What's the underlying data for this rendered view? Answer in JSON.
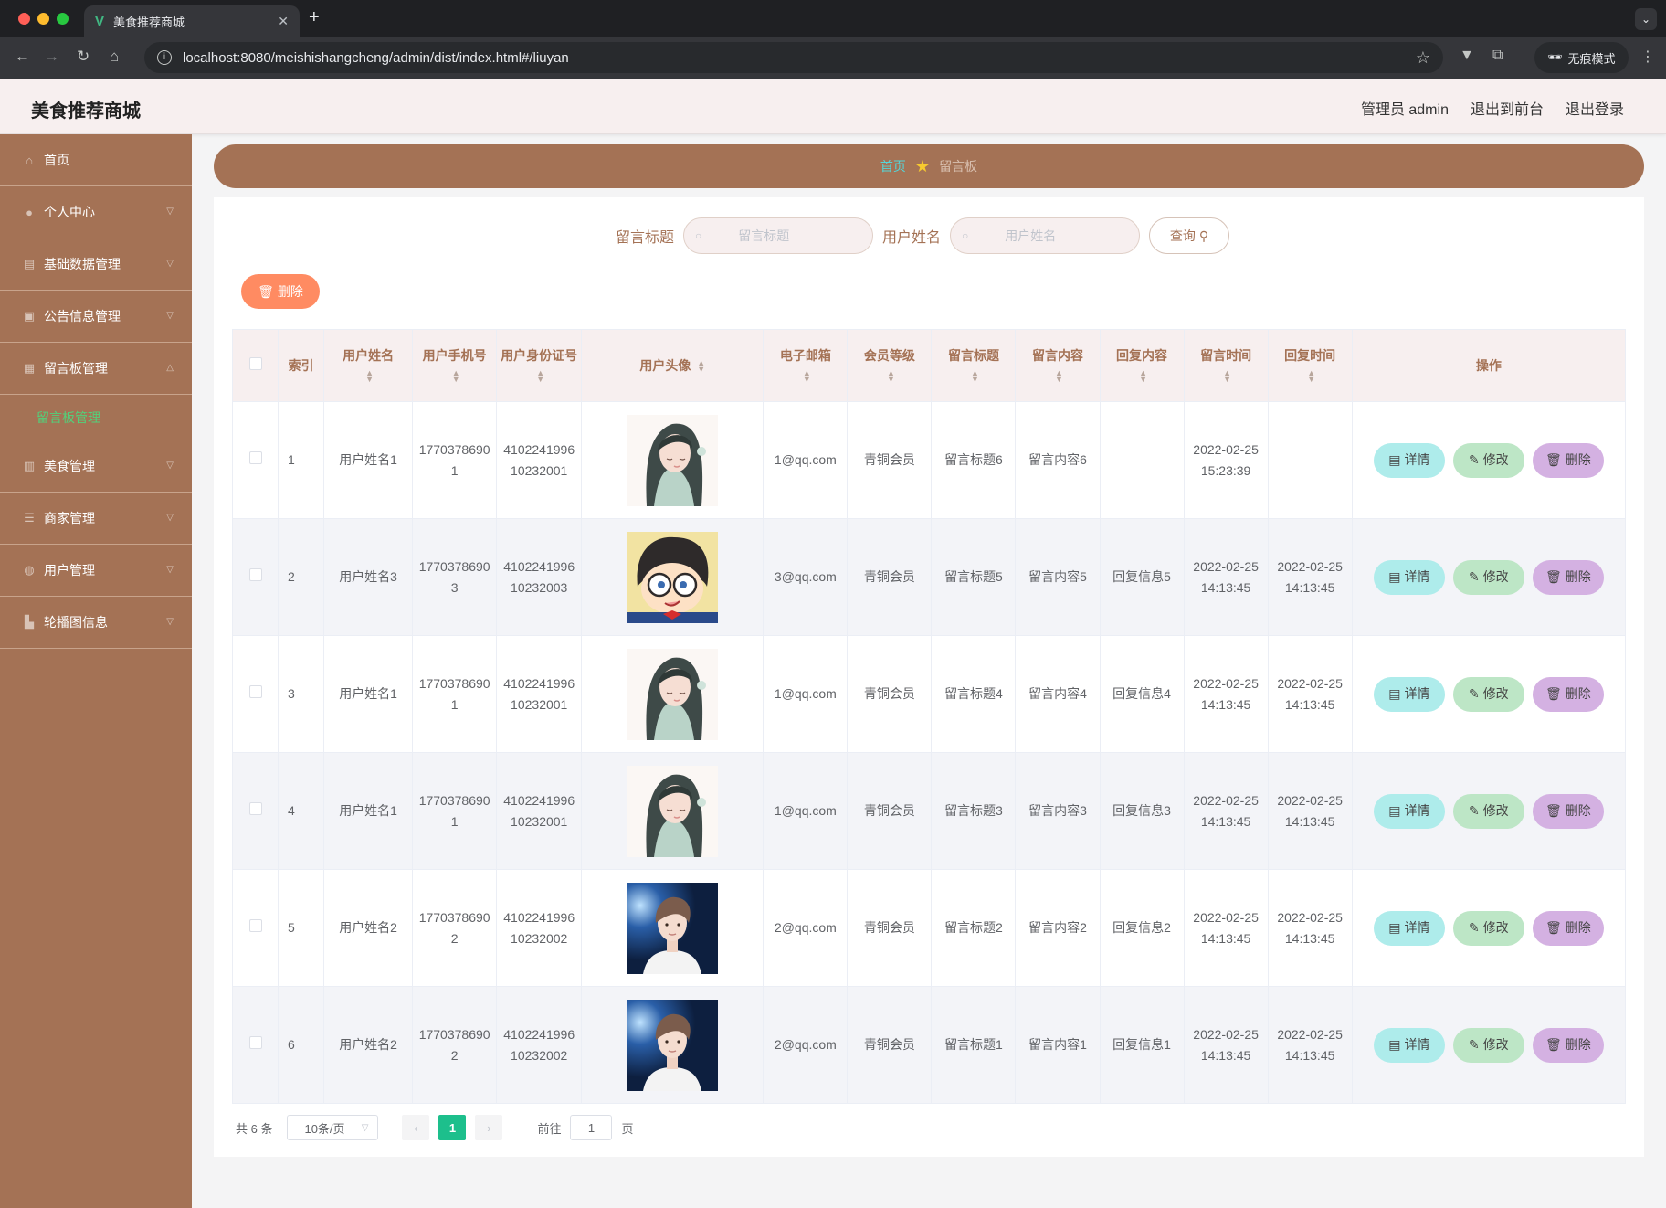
{
  "browser": {
    "tab_title": "美食推荐商城",
    "url": "localhost:8080/meishishangcheng/admin/dist/index.html#/liuyan",
    "incognito_label": "无痕模式"
  },
  "header": {
    "title": "美食推荐商城",
    "user": "管理员 admin",
    "to_front": "退出到前台",
    "logout": "退出登录"
  },
  "sidebar": {
    "items": [
      {
        "label": "首页",
        "icon": "home-icon"
      },
      {
        "label": "个人中心",
        "icon": "user-icon"
      },
      {
        "label": "基础数据管理",
        "icon": "data-icon"
      },
      {
        "label": "公告信息管理",
        "icon": "notice-icon"
      },
      {
        "label": "留言板管理",
        "icon": "grid-icon"
      },
      {
        "label": "美食管理",
        "icon": "food-icon"
      },
      {
        "label": "商家管理",
        "icon": "list-icon"
      },
      {
        "label": "用户管理",
        "icon": "users-icon"
      },
      {
        "label": "轮播图信息",
        "icon": "chart-icon"
      }
    ],
    "active_sub": "留言板管理"
  },
  "breadcrumb": {
    "home": "首页",
    "current": "留言板"
  },
  "search": {
    "title_label": "留言标题",
    "title_placeholder": "留言标题",
    "name_label": "用户姓名",
    "name_placeholder": "用户姓名",
    "query_button": "查询"
  },
  "toolbar": {
    "delete_label": "删除"
  },
  "table": {
    "headers": {
      "index": "索引",
      "name": "用户姓名",
      "phone": "用户手机号",
      "idcard": "用户身份证号",
      "avatar": "用户头像",
      "email": "电子邮箱",
      "level": "会员等级",
      "title": "留言标题",
      "content": "留言内容",
      "reply": "回复内容",
      "msg_time": "留言时间",
      "reply_time": "回复时间",
      "ops": "操作"
    },
    "rows": [
      {
        "index": "1",
        "name": "用户姓名1",
        "phone": "17703786901",
        "idcard": "410224199610232001",
        "avatar": "anime-girl",
        "email": "1@qq.com",
        "level": "青铜会员",
        "title": "留言标题6",
        "content": "留言内容6",
        "reply": "",
        "msg_time": "2022-02-25 15:23:39",
        "reply_time": ""
      },
      {
        "index": "2",
        "name": "用户姓名3",
        "phone": "17703786903",
        "idcard": "410224199610232003",
        "avatar": "cartoon-detective",
        "email": "3@qq.com",
        "level": "青铜会员",
        "title": "留言标题5",
        "content": "留言内容5",
        "reply": "回复信息5",
        "msg_time": "2022-02-25 14:13:45",
        "reply_time": "2022-02-25 14:13:45"
      },
      {
        "index": "3",
        "name": "用户姓名1",
        "phone": "17703786901",
        "idcard": "410224199610232001",
        "avatar": "anime-girl",
        "email": "1@qq.com",
        "level": "青铜会员",
        "title": "留言标题4",
        "content": "留言内容4",
        "reply": "回复信息4",
        "msg_time": "2022-02-25 14:13:45",
        "reply_time": "2022-02-25 14:13:45"
      },
      {
        "index": "4",
        "name": "用户姓名1",
        "phone": "17703786901",
        "idcard": "410224199610232001",
        "avatar": "anime-girl",
        "email": "1@qq.com",
        "level": "青铜会员",
        "title": "留言标题3",
        "content": "留言内容3",
        "reply": "回复信息3",
        "msg_time": "2022-02-25 14:13:45",
        "reply_time": "2022-02-25 14:13:45"
      },
      {
        "index": "5",
        "name": "用户姓名2",
        "phone": "17703786902",
        "idcard": "410224199610232002",
        "avatar": "stage-portrait",
        "email": "2@qq.com",
        "level": "青铜会员",
        "title": "留言标题2",
        "content": "留言内容2",
        "reply": "回复信息2",
        "msg_time": "2022-02-25 14:13:45",
        "reply_time": "2022-02-25 14:13:45"
      },
      {
        "index": "6",
        "name": "用户姓名2",
        "phone": "17703786902",
        "idcard": "410224199610232002",
        "avatar": "stage-portrait",
        "email": "2@qq.com",
        "level": "青铜会员",
        "title": "留言标题1",
        "content": "留言内容1",
        "reply": "回复信息1",
        "msg_time": "2022-02-25 14:13:45",
        "reply_time": "2022-02-25 14:13:45"
      }
    ],
    "ops": {
      "detail": "详情",
      "edit": "修改",
      "delete": "删除"
    }
  },
  "pagination": {
    "total": "共 6 条",
    "page_size": "10条/页",
    "current_page": "1",
    "goto_prefix": "前往",
    "goto_value": "1",
    "goto_suffix": "页"
  },
  "colors": {
    "brand": "#a47255",
    "header_bg": "#f7efef",
    "delete_button": "#ff8b62",
    "detail_button": "#aeeceb",
    "edit_button": "#bde6c6",
    "row_delete_button": "#d4b1e2",
    "active_page": "#1dbf8c"
  }
}
